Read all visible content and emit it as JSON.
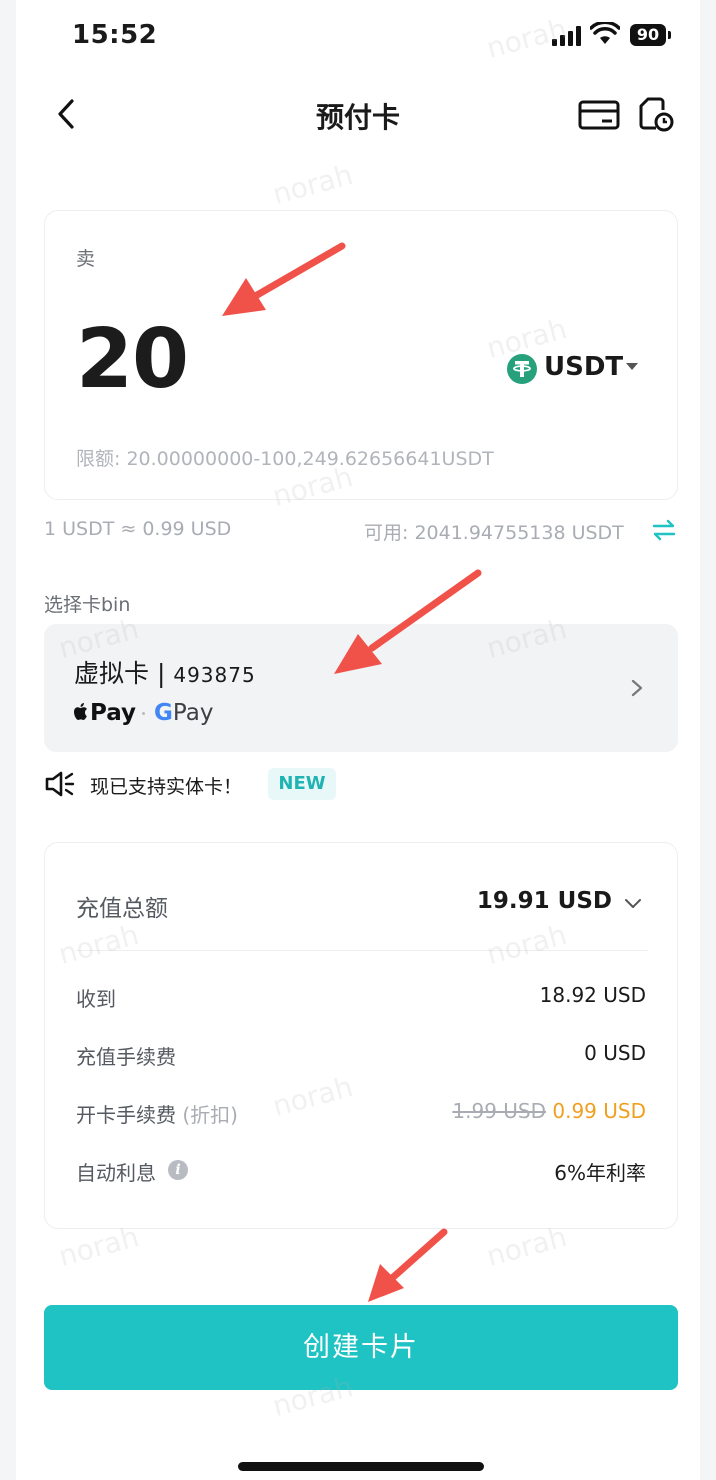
{
  "status_bar": {
    "time": "15:52",
    "battery": "90"
  },
  "header": {
    "title": "预付卡"
  },
  "amount_card": {
    "sell_label": "卖",
    "amount": "20",
    "currency": "USDT",
    "limit_text": "限额: 20.00000000-100,249.62656641USDT"
  },
  "rate_text": "1 USDT ≈ 0.99 USD",
  "available_text": "可用: 2041.94755138 USDT",
  "card_bin": {
    "section_label": "选择卡bin",
    "card_type": "虚拟卡",
    "separator": " | ",
    "bin_number": "493875",
    "apple_pay": "Pay",
    "google_pay_g": "G",
    "google_pay": "Pay"
  },
  "notice": {
    "text": "现已支持实体卡！",
    "badge": "NEW"
  },
  "summary": {
    "total_label": "充值总额",
    "total_value": "19.91 USD",
    "rows": [
      {
        "label": "收到",
        "value": "18.92 USD"
      },
      {
        "label": "充值手续费",
        "value": "0 USD"
      },
      {
        "label": "开卡手续费",
        "label_note": "(折扣)",
        "old_value": "1.99 USD",
        "value": "0.99 USD"
      },
      {
        "label": "自动利息",
        "value": "6%年利率"
      }
    ]
  },
  "create_button_label": "创建卡片",
  "watermark": "norah",
  "colors": {
    "accent": "#1fc3c3",
    "discount": "#f0a020",
    "arrow": "#f0524a",
    "tether": "#26a17b"
  }
}
